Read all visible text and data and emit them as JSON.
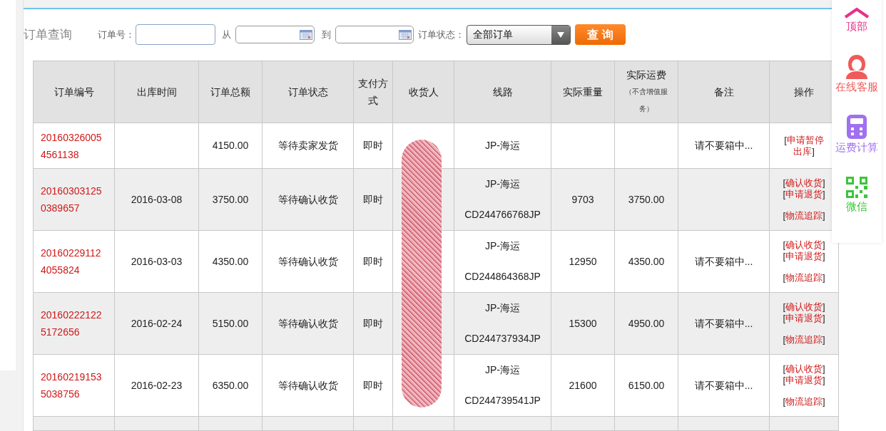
{
  "query": {
    "title": "订单查询",
    "order_no_label": "订单号：",
    "from_label": "从",
    "to_label": "到",
    "status_label": "订单状态：",
    "status_value": "全部订单",
    "submit": "查 询"
  },
  "table": {
    "columns": [
      {
        "label": "订单编号"
      },
      {
        "label": "出库时间"
      },
      {
        "label": "订单总额"
      },
      {
        "label": "订单状态"
      },
      {
        "label": "支付方式"
      },
      {
        "label": "收货人"
      },
      {
        "label": "线路"
      },
      {
        "label": "实际重量"
      },
      {
        "label": "实际运费",
        "note": "（不含增值服务）"
      },
      {
        "label": "备注"
      },
      {
        "label": "操作"
      }
    ],
    "rows": [
      {
        "order_no": "201603260054561138",
        "ship_date": "",
        "total": "4150.00",
        "status": "等待卖家发货",
        "payment": "即时",
        "route": "JP-海运",
        "tracking": "",
        "weight": "",
        "freight": "",
        "remark": "请不要箱中...",
        "actions": [
          "[申请暂停出库]"
        ]
      },
      {
        "order_no": "201603031250389657",
        "ship_date": "2016-03-08",
        "total": "3750.00",
        "status": "等待确认收货",
        "payment": "即时",
        "route": "JP-海运",
        "tracking": "CD244766768JP",
        "weight": "9703",
        "freight": "3750.00",
        "remark": "",
        "actions": [
          "[确认收货]",
          "[申请退货]",
          "[物流追踪]"
        ]
      },
      {
        "order_no": "201602291124055824",
        "ship_date": "2016-03-03",
        "total": "4350.00",
        "status": "等待确认收货",
        "payment": "即时",
        "route": "JP-海运",
        "tracking": "CD244864368JP",
        "weight": "12950",
        "freight": "4350.00",
        "remark": "请不要箱中...",
        "actions": [
          "[确认收货]",
          "[申请退货]",
          "[物流追踪]"
        ]
      },
      {
        "order_no": "201602221225172656",
        "ship_date": "2016-02-24",
        "total": "5150.00",
        "status": "等待确认收货",
        "payment": "即时",
        "route": "JP-海运",
        "tracking": "CD244737934JP",
        "weight": "15300",
        "freight": "4950.00",
        "remark": "请不要箱中...",
        "actions": [
          "[确认收货]",
          "[申请退货]",
          "[物流追踪]"
        ]
      },
      {
        "order_no": "201602191535038756",
        "ship_date": "2016-02-23",
        "total": "6350.00",
        "status": "等待确认收货",
        "payment": "即时",
        "route": "JP-海运",
        "tracking": "CD244739541JP",
        "weight": "21600",
        "freight": "6150.00",
        "remark": "请不要箱中...",
        "actions": [
          "[确认收货]",
          "[申请退货]",
          "[物流追踪]"
        ]
      }
    ]
  },
  "sidebar": {
    "items": [
      {
        "kind": "top",
        "label": "顶部",
        "color": "#e8318a"
      },
      {
        "kind": "service",
        "label": "在线客服",
        "color": "#f05a5a"
      },
      {
        "kind": "calculator",
        "label": "运费计算",
        "color": "#a070f0"
      },
      {
        "kind": "wechat",
        "label": "微信",
        "color": "#3cc43c"
      }
    ]
  }
}
